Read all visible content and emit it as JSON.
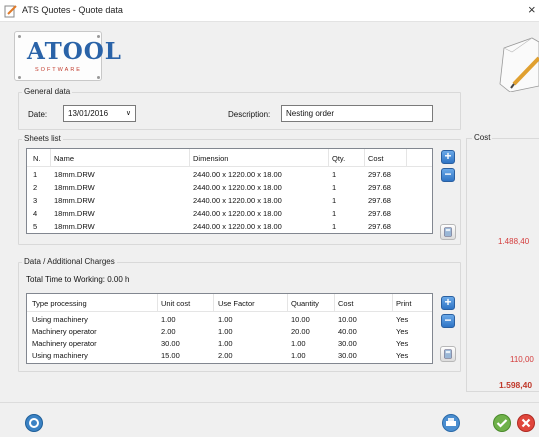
{
  "window": {
    "title": "ATS Quotes - Quote data",
    "close": "×"
  },
  "logo": {
    "word": "ATOOL",
    "sub": "SOFTWARE"
  },
  "general": {
    "label": "General data",
    "date_label": "Date:",
    "date_value": "13/01/2016",
    "desc_label": "Description:",
    "desc_value": "Nesting order"
  },
  "sheets": {
    "label": "Sheets list",
    "headers": [
      "N.",
      "Name",
      "Dimension",
      "Qty.",
      "Cost"
    ],
    "rows": [
      [
        "1",
        "18mm.DRW",
        "2440.00 x 1220.00 x 18.00",
        "1",
        "297.68"
      ],
      [
        "2",
        "18mm.DRW",
        "2440.00 x 1220.00 x 18.00",
        "1",
        "297.68"
      ],
      [
        "3",
        "18mm.DRW",
        "2440.00 x 1220.00 x 18.00",
        "1",
        "297.68"
      ],
      [
        "4",
        "18mm.DRW",
        "2440.00 x 1220.00 x 18.00",
        "1",
        "297.68"
      ],
      [
        "5",
        "18mm.DRW",
        "2440.00 x 1220.00 x 18.00",
        "1",
        "297.68"
      ]
    ]
  },
  "charges": {
    "label": "Data / Additional Charges",
    "total_time": "Total Time to Working: 0.00 h",
    "headers": [
      "Type processing",
      "Unit cost",
      "Use Factor",
      "Quantity",
      "Cost",
      "Print"
    ],
    "rows": [
      [
        "Using machinery",
        "1.00",
        "1.00",
        "10.00",
        "10.00",
        "Yes"
      ],
      [
        "Machinery operator",
        "2.00",
        "1.00",
        "20.00",
        "40.00",
        "Yes"
      ],
      [
        "Machinery operator",
        "30.00",
        "1.00",
        "1.00",
        "30.00",
        "Yes"
      ],
      [
        "Using machinery",
        "15.00",
        "2.00",
        "1.00",
        "30.00",
        "Yes"
      ]
    ]
  },
  "cost": {
    "label": "Cost",
    "sheets_total": "1.488,40",
    "charges_total": "110,00",
    "grand_total": "1.598,40"
  },
  "colors": {
    "accent": "#2f74c4",
    "cost_red": "#d43c3c"
  },
  "icons": {
    "add": "+",
    "remove": "−",
    "calculator": "calculator-icon",
    "back": "back-icon",
    "print": "print-icon",
    "confirm": "check-icon",
    "cancel": "cancel-icon"
  }
}
